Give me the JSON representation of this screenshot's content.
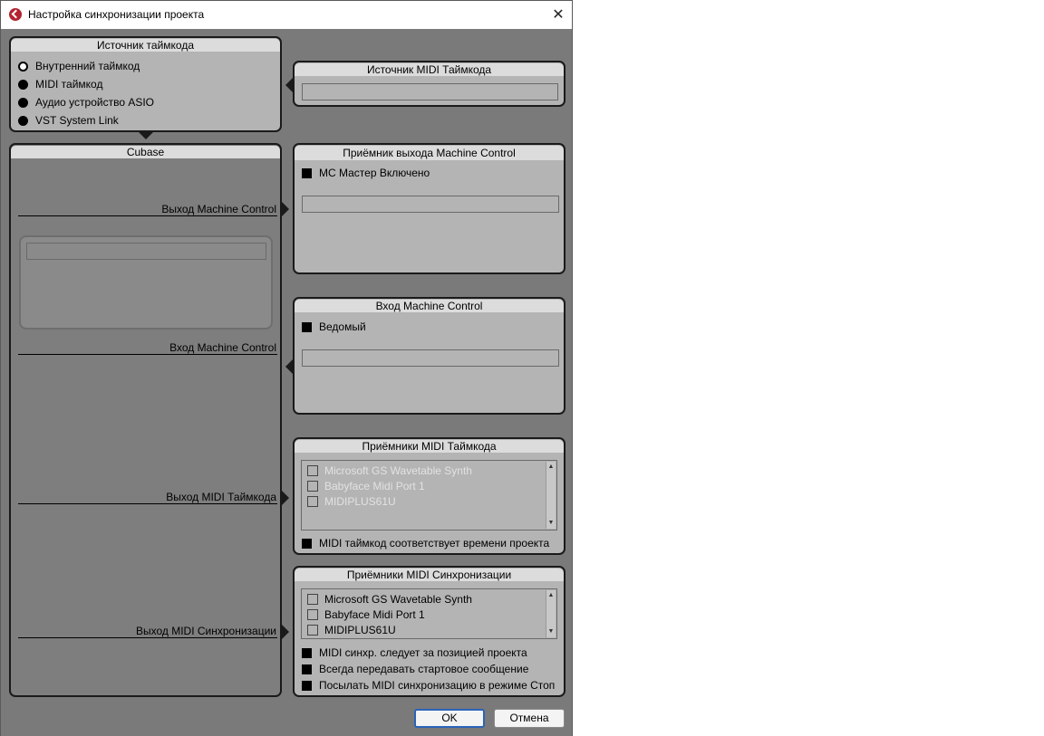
{
  "window": {
    "title": "Настройка синхронизации проекта",
    "close_glyph": "✕"
  },
  "timecode_source": {
    "title": "Источник таймкода",
    "options": [
      {
        "label": "Внутренний таймкод",
        "selected": true
      },
      {
        "label": "MIDI таймкод",
        "selected": false
      },
      {
        "label": "Аудио устройство ASIO",
        "selected": false
      },
      {
        "label": "VST System Link",
        "selected": false
      }
    ]
  },
  "midi_timecode_source": {
    "title": "Источник MIDI Таймкода",
    "field_value": ""
  },
  "cubase": {
    "title": "Cubase",
    "routes": {
      "mc_out": "Выход Machine Control",
      "mc_in": "Вход Machine Control",
      "midi_tc_out": "Выход MIDI Таймкода",
      "midi_sync_out": "Выход MIDI Синхронизации"
    }
  },
  "mc_output": {
    "title": "Приёмник выхода Machine Control",
    "checkbox_label": "MC Мастер Включено",
    "field_value": ""
  },
  "mc_input": {
    "title": "Вход Machine Control",
    "checkbox_label": "Ведомый",
    "field_value": ""
  },
  "midi_tc_dest": {
    "title": "Приёмники MIDI Таймкода",
    "ports": [
      "Microsoft GS Wavetable Synth",
      "Babyface Midi Port 1",
      "MIDIPLUS61U"
    ],
    "option_label": "MIDI таймкод соответствует времени проекта"
  },
  "midi_sync_dest": {
    "title": "Приёмники MIDI Синхронизации",
    "ports": [
      "Microsoft GS Wavetable Synth",
      "Babyface Midi Port 1",
      "MIDIPLUS61U"
    ],
    "options": [
      "MIDI синхр. следует за позицией проекта",
      "Всегда передавать стартовое сообщение",
      "Посылать MIDI синхронизацию в режиме Стоп"
    ]
  },
  "buttons": {
    "ok": "OK",
    "cancel": "Отмена"
  },
  "colors": {
    "dialog_bg": "#7a7a7a",
    "panel_bg": "#b4b4b4",
    "panel_header": "#dcdcdc",
    "accent": "#2a64b8",
    "brand": "#b32330"
  }
}
